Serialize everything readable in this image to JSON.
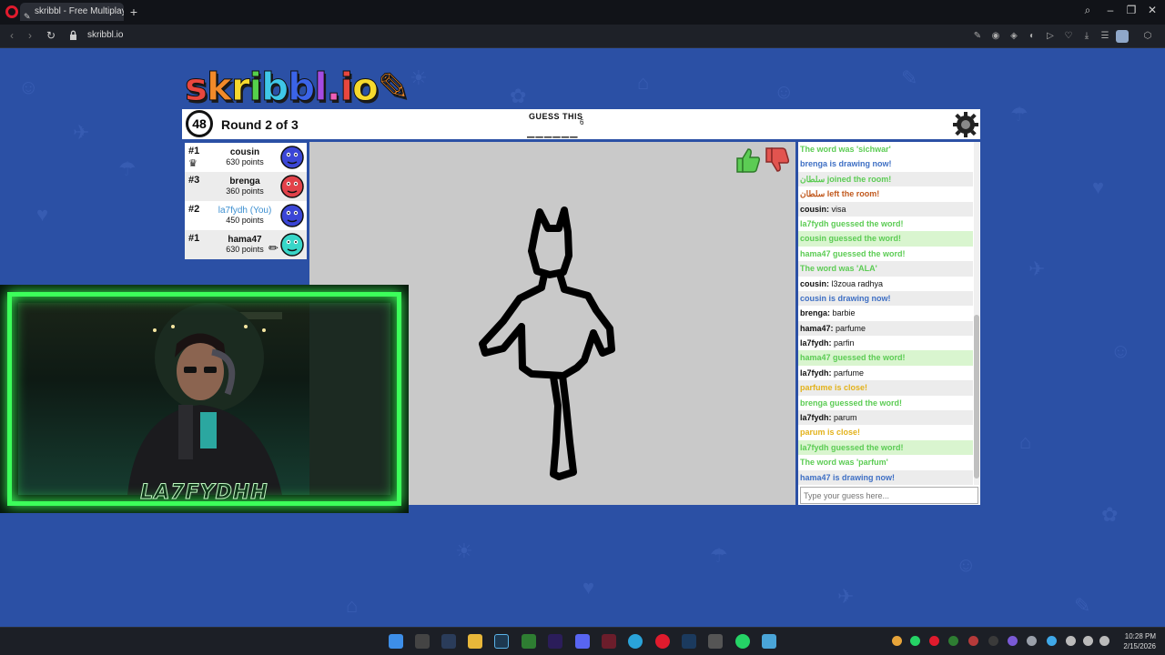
{
  "browser": {
    "tab_title": "skribbl - Free Multiplayer",
    "url": "skribbl.io"
  },
  "game": {
    "logo": "skribbl.io",
    "timer": "48",
    "round_text": "Round 2 of 3",
    "guess_label": "GUESS THIS",
    "word_length": "6",
    "word_blanks": "______"
  },
  "players": [
    {
      "rank": "#1",
      "name": "cousin",
      "points": "630 points",
      "avatar_color": "#3b46d6",
      "crown": true,
      "you": false
    },
    {
      "rank": "#3",
      "name": "brenga",
      "points": "360 points",
      "avatar_color": "#e2424a",
      "crown": false,
      "you": false
    },
    {
      "rank": "#2",
      "name": "la7fydh (You)",
      "points": "450 points",
      "avatar_color": "#3b46d6",
      "crown": false,
      "you": true
    },
    {
      "rank": "#1",
      "name": "hama47",
      "points": "630 points",
      "avatar_color": "#38d6c8",
      "crown": false,
      "you": false,
      "drawing": true
    }
  ],
  "chat": {
    "messages": [
      {
        "style": "green",
        "user": "",
        "text": "The word was 'sichwar'"
      },
      {
        "style": "blue",
        "user": "",
        "text": "brenga is drawing now!"
      },
      {
        "style": "green alt",
        "user": "",
        "text": "سلطان joined the room!"
      },
      {
        "style": "orange",
        "user": "",
        "text": "سلطان left the room!"
      },
      {
        "style": "alt",
        "user": "cousin:",
        "text": " visa"
      },
      {
        "style": "green",
        "user": "",
        "text": "la7fydh guessed the word!"
      },
      {
        "style": "greenbg",
        "user": "",
        "text": "cousin guessed the word!"
      },
      {
        "style": "green",
        "user": "",
        "text": "hama47 guessed the word!"
      },
      {
        "style": "green alt",
        "user": "",
        "text": "The word was 'ALA'"
      },
      {
        "style": "",
        "user": "cousin:",
        "text": " l3zoua radhya"
      },
      {
        "style": "blue alt",
        "user": "",
        "text": "cousin is drawing now!"
      },
      {
        "style": "",
        "user": "brenga:",
        "text": " barbie"
      },
      {
        "style": "alt",
        "user": "hama47:",
        "text": " parfume"
      },
      {
        "style": "",
        "user": "la7fydh:",
        "text": " parfin"
      },
      {
        "style": "greenbg",
        "user": "",
        "text": "hama47 guessed the word!"
      },
      {
        "style": "",
        "user": "la7fydh:",
        "text": " parfume"
      },
      {
        "style": "yellow alt",
        "user": "",
        "text": "parfume is close!"
      },
      {
        "style": "green",
        "user": "",
        "text": "brenga guessed the word!"
      },
      {
        "style": "alt",
        "user": "la7fydh:",
        "text": " parum"
      },
      {
        "style": "yellow",
        "user": "",
        "text": "parum is close!"
      },
      {
        "style": "greenbg",
        "user": "",
        "text": "la7fydh guessed the word!"
      },
      {
        "style": "green",
        "user": "",
        "text": "The word was 'parfum'"
      },
      {
        "style": "blue alt",
        "user": "",
        "text": "hama47 is drawing now!"
      }
    ],
    "input_placeholder": "Type your guess here..."
  },
  "stream_overlay": {
    "name": "LA7FYDHH"
  },
  "taskbar": {
    "time": "10:28 PM",
    "date": "2/15/2026"
  },
  "colors": {
    "page_bg": "#2b50a5",
    "canvas_bg": "#c9c9c9",
    "cam_glow": "#3cff5a"
  }
}
